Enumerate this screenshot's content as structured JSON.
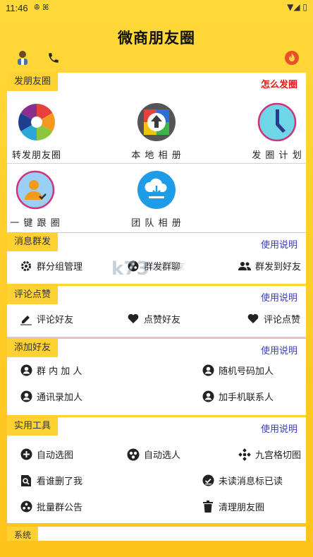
{
  "status": {
    "time": "11:46",
    "left_icons": "ꔮ ꕤ",
    "right_icons": "▼◢ ▯"
  },
  "app": {
    "title": "微商朋友圈"
  },
  "sections": {
    "post": {
      "label": "发朋友圈",
      "link": "怎么发圈",
      "items": [
        {
          "label": "转发朋友圈"
        },
        {
          "label": "本 地 相 册"
        },
        {
          "label": "发 圈 计 划"
        },
        {
          "label": "一 键 跟 圈"
        },
        {
          "label": "团 队 相 册"
        }
      ]
    },
    "broadcast": {
      "label": "消息群发",
      "link": "使用说明",
      "items": [
        {
          "label": "群分组管理"
        },
        {
          "label": "群发群聊"
        },
        {
          "label": "群发到好友"
        }
      ]
    },
    "comment": {
      "label": "评论点赞",
      "link": "使用说明",
      "items": [
        {
          "label": "评论好友"
        },
        {
          "label": "点赞好友"
        },
        {
          "label": "评论点赞"
        }
      ]
    },
    "friends": {
      "label": "添加好友",
      "link": "使用说明",
      "items": [
        {
          "label": "群 内 加 人"
        },
        {
          "label": "随机号码加人"
        },
        {
          "label": "通讯录加人"
        },
        {
          "label": "加手机联系人"
        }
      ]
    },
    "tools": {
      "label": "实用工具",
      "link": "使用说明",
      "items": [
        {
          "label": "自动选图"
        },
        {
          "label": "自动选人"
        },
        {
          "label": "九宫格切图"
        },
        {
          "label": "看谁删了我"
        },
        {
          "label": "未读消息标已读"
        },
        {
          "label": "批量群公告"
        },
        {
          "label": "清理朋友圈"
        }
      ]
    },
    "system": {
      "label": "系统"
    }
  },
  "watermark": {
    "text": "k73",
    "sub": "游戏之家"
  }
}
